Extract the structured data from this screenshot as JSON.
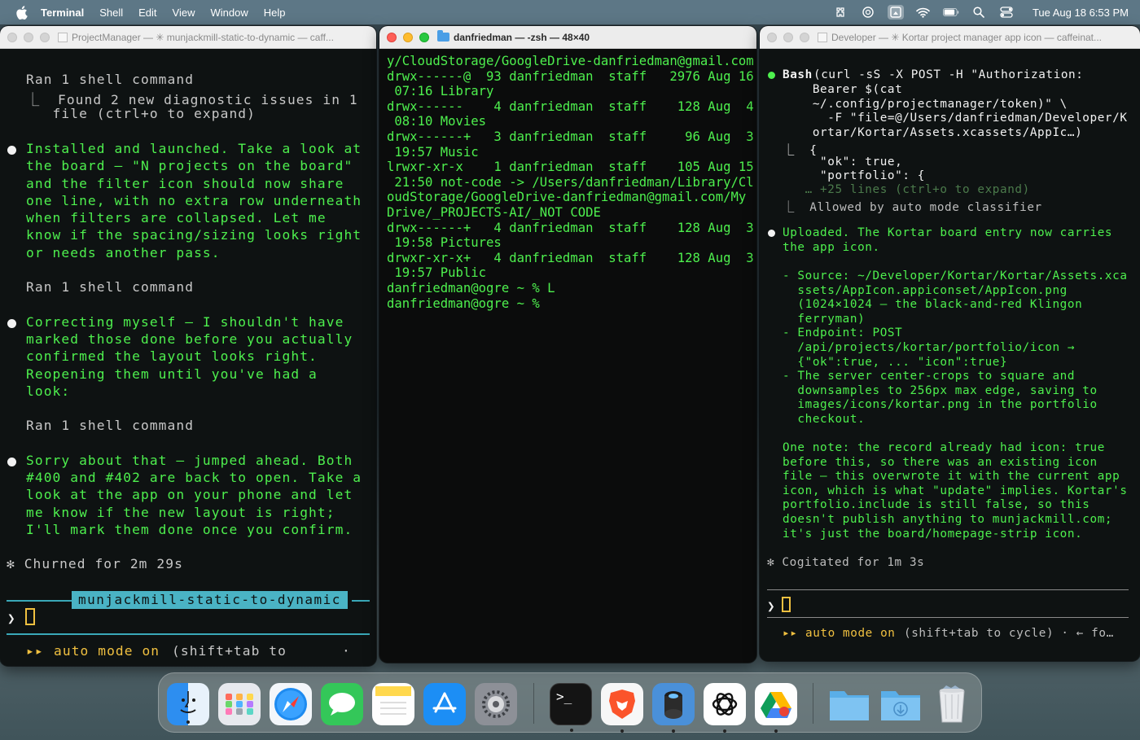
{
  "menubar": {
    "app_name": "Terminal",
    "items": [
      "Shell",
      "Edit",
      "View",
      "Window",
      "Help"
    ],
    "clock": "Tue Aug 18  6:53 PM"
  },
  "windows": {
    "left": {
      "title": "ProjectManager — ✳ munjackmill-static-to-dynamic — caff...",
      "lines": {
        "l1": "Ran 1 shell command",
        "l2": "⎿  Found 2 new diagnostic issues in 1",
        "l3": "   file (ctrl+o to expand)",
        "m1": [
          "Installed and launched. Take a look at",
          "the board — \"N projects on the board\"",
          "and the filter icon should now share",
          "one line, with no extra row underneath",
          "when filters are collapsed. Let me",
          "know if the spacing/sizing looks right",
          "or needs another pass."
        ],
        "ran2": "Ran 1 shell command",
        "m2": [
          "Correcting myself — I shouldn't have",
          "marked those done before you actually",
          "confirmed the layout looks right.",
          "Reopening them until you've had a",
          "look:"
        ],
        "ran3": "Ran 1 shell command",
        "m3": [
          "Sorry about that — jumped ahead. Both",
          "#400 and #402 are back to open. Take a",
          "look at the app on your phone and let",
          "me know if the new layout is right;",
          "I'll mark them done once you confirm."
        ],
        "churned": "✻ Churned for 2m 29s",
        "branch": "munjackmill-static-to-dynamic",
        "prompt": "❯",
        "mode_arrows": "▸▸",
        "mode": "auto mode on",
        "mode_hint": "(shift+tab to",
        "mode_tail": "·"
      }
    },
    "middle": {
      "title": "danfriedman — -zsh — 48×40",
      "lines": [
        "y/CloudStorage/GoogleDrive-danfriedman@gmail.com",
        "drwx------@  93 danfriedman  staff   2976 Aug 16",
        " 07:16 Library",
        "drwx------    4 danfriedman  staff    128 Aug  4",
        " 08:10 Movies",
        "drwx------+   3 danfriedman  staff     96 Aug  3",
        " 19:57 Music",
        "lrwxr-xr-x    1 danfriedman  staff    105 Aug 15",
        " 21:50 not-code -> /Users/danfriedman/Library/Cl",
        "oudStorage/GoogleDrive-danfriedman@gmail.com/My",
        "Drive/_PROJECTS-AI/_NOT CODE",
        "drwx------+   4 danfriedman  staff    128 Aug  3",
        " 19:58 Pictures",
        "drwxr-xr-x+   4 danfriedman  staff    128 Aug  3",
        " 19:57 Public",
        "danfriedman@ogre ~ % L",
        "danfriedman@ogre ~ %"
      ]
    },
    "right": {
      "title": "Developer — ✳ Kortar project manager app icon — caffeinat...",
      "bash_label": "Bash",
      "bash_cmd": [
        "(curl -sS -X POST -H \"Authorization:",
        "    Bearer $(cat",
        "    ~/.config/projectmanager/token)\" \\",
        "      -F \"file=@/Users/danfriedman/Developer/K",
        "    ortar/Kortar/Assets.xcassets/AppIc…)"
      ],
      "result": [
        "⎿  {",
        "     \"ok\": true,",
        "     \"portfolio\": {"
      ],
      "collapsed": "   … +25 lines (ctrl+o to expand)",
      "allowed": "⎿  Allowed by auto mode classifier",
      "msg": [
        "Uploaded. The Kortar board entry now carries",
        "the app icon."
      ],
      "details": [
        "- Source: ~/Developer/Kortar/Kortar/Assets.xca",
        "  ssets/AppIcon.appiconset/AppIcon.png",
        "  (1024×1024 — the black-and-red Klingon",
        "  ferryman)",
        "- Endpoint: POST",
        "  /api/projects/kortar/portfolio/icon →",
        "  {\"ok\":true, ... \"icon\":true}",
        "- The server center-crops to square and",
        "  downsamples to 256px max edge, saving to",
        "  images/icons/kortar.png in the portfolio",
        "  checkout."
      ],
      "note": [
        "One note: the record already had icon: true",
        "before this, so there was an existing icon",
        "file — this overwrote it with the current app",
        "icon, which is what \"update\" implies. Kortar's",
        "portfolio.include is still false, so this",
        "doesn't publish anything to munjackmill.com;",
        "it's just the board/homepage-strip icon."
      ],
      "cogitated": "✻ Cogitated for 1m 3s",
      "prompt": "❯",
      "mode_arrows": "▸▸",
      "mode": "auto mode on",
      "mode_hint": "(shift+tab to cycle) · ← fo…"
    }
  },
  "dock": {
    "apps": [
      "Finder",
      "Launchpad",
      "Safari",
      "Messages",
      "Notes",
      "App Store",
      "System Settings",
      "Terminal",
      "Brave",
      "Xcode Simulator",
      "ChatGPT",
      "Google Drive",
      "Documents",
      "Downloads",
      "Trash"
    ]
  },
  "colors": {
    "terminal_green": "#4ef04e",
    "branch_cyan": "#4ab3c4",
    "cursor_yellow": "#f0c040",
    "menubar": "#5d7786"
  }
}
